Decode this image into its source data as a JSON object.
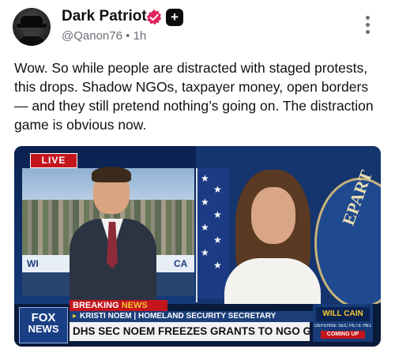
{
  "post": {
    "author_name": "Dark Patriot",
    "handle": "@Qanon76",
    "separator": "•",
    "time": "1h",
    "plus_badge": "+",
    "text": "Wow. So while people are distracted with staged protests, this drops. Shadow NGOs, taxpayer money, open borders — and they still pretend nothing’s going on. The distraction game is obvious now."
  },
  "icons": {
    "verified": "verified-badge-icon",
    "plus": "plus-badge-icon",
    "more": "more-options-icon"
  },
  "colors": {
    "verified_fill": "#e0245e",
    "fox_red": "#c4151c",
    "fox_blue": "#1c3f7a"
  },
  "media": {
    "live_label": "LIVE",
    "banner_left": "WI",
    "banner_right": "CA",
    "breaking_word1": "BREAKING",
    "breaking_word2": "NEWS",
    "subline_name": "KRISTI NOEM",
    "subline_sep": "|",
    "subline_title": "HOMELAND SECURITY SECRETARY",
    "headline": "DHS SEC NOEM FREEZES GRANTS TO NGO GROUPS",
    "network_line1": "FOX",
    "network_line2": "NEWS",
    "ticker_brand": "WILL CAIN",
    "ticker_line2": "DEFENSE SEC PETE HEGSETH",
    "ticker_line3": "COMING UP",
    "seal_text": "EPART"
  }
}
